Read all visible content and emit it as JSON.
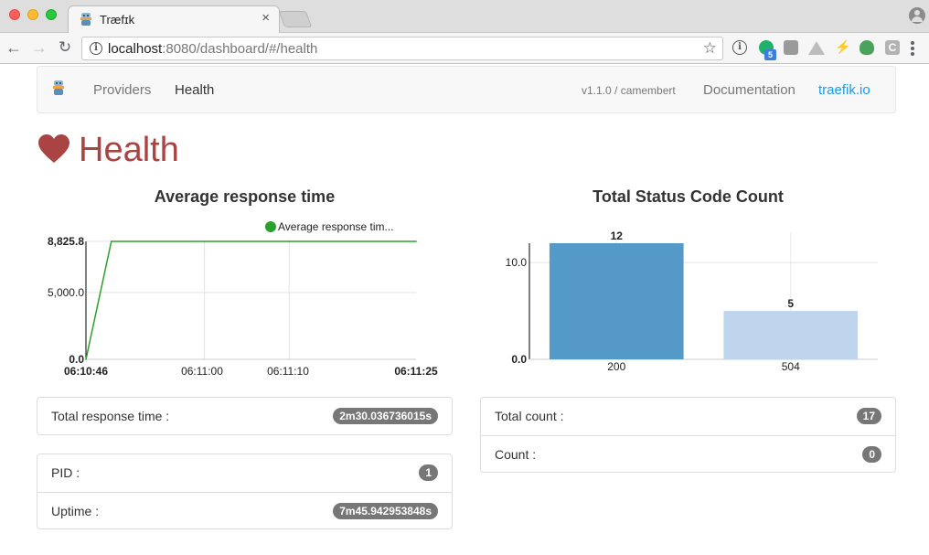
{
  "browser": {
    "tab_title": "Træfɪk",
    "url_host": "localhost",
    "url_rest": ":8080/dashboard/#/health",
    "extension_badge": "5",
    "extension_c_label": "C"
  },
  "navbar": {
    "providers": "Providers",
    "health": "Health",
    "version": "v1.1.0 / camembert",
    "documentation": "Documentation",
    "traefik_link": "traefik.io"
  },
  "page": {
    "title": "Health",
    "accent_color": "#a94442"
  },
  "response_chart": {
    "title": "Average response time",
    "legend": "Average response tim...",
    "color": "#2ca02c",
    "y_ticks": [
      "8,825.8",
      "5,000.0",
      "0.0"
    ],
    "x_ticks": [
      "06:10:46",
      "06:11:00",
      "06:11:10",
      "06:11:25"
    ]
  },
  "status_chart": {
    "title": "Total Status Code Count",
    "y_ticks": [
      "10.0",
      "0.0"
    ],
    "colors": [
      "#5599c8",
      "#bfd5ee"
    ]
  },
  "panels": {
    "total_response_time_label": "Total response time :",
    "total_response_time_value": "2m30.036736015s",
    "pid_label": "PID :",
    "pid_value": "1",
    "uptime_label": "Uptime :",
    "uptime_value": "7m45.942953848s",
    "total_count_label": "Total count :",
    "total_count_value": "17",
    "count_label": "Count :",
    "count_value": "0"
  },
  "chart_data": [
    {
      "type": "line",
      "title": "Average response time",
      "xlabel": "",
      "ylabel": "",
      "x": [
        "06:10:46",
        "06:10:49",
        "06:11:00",
        "06:11:10",
        "06:11:25"
      ],
      "series": [
        {
          "name": "Average response tim...",
          "values": [
            0,
            8825.8,
            8825.8,
            8825.8,
            8825.8
          ]
        }
      ],
      "ylim": [
        0,
        8825.8
      ],
      "grid": true,
      "legend": "top-right"
    },
    {
      "type": "bar",
      "title": "Total Status Code Count",
      "categories": [
        "200",
        "504"
      ],
      "values": [
        12,
        5
      ],
      "ylim": [
        0,
        12
      ],
      "grid": true
    }
  ]
}
